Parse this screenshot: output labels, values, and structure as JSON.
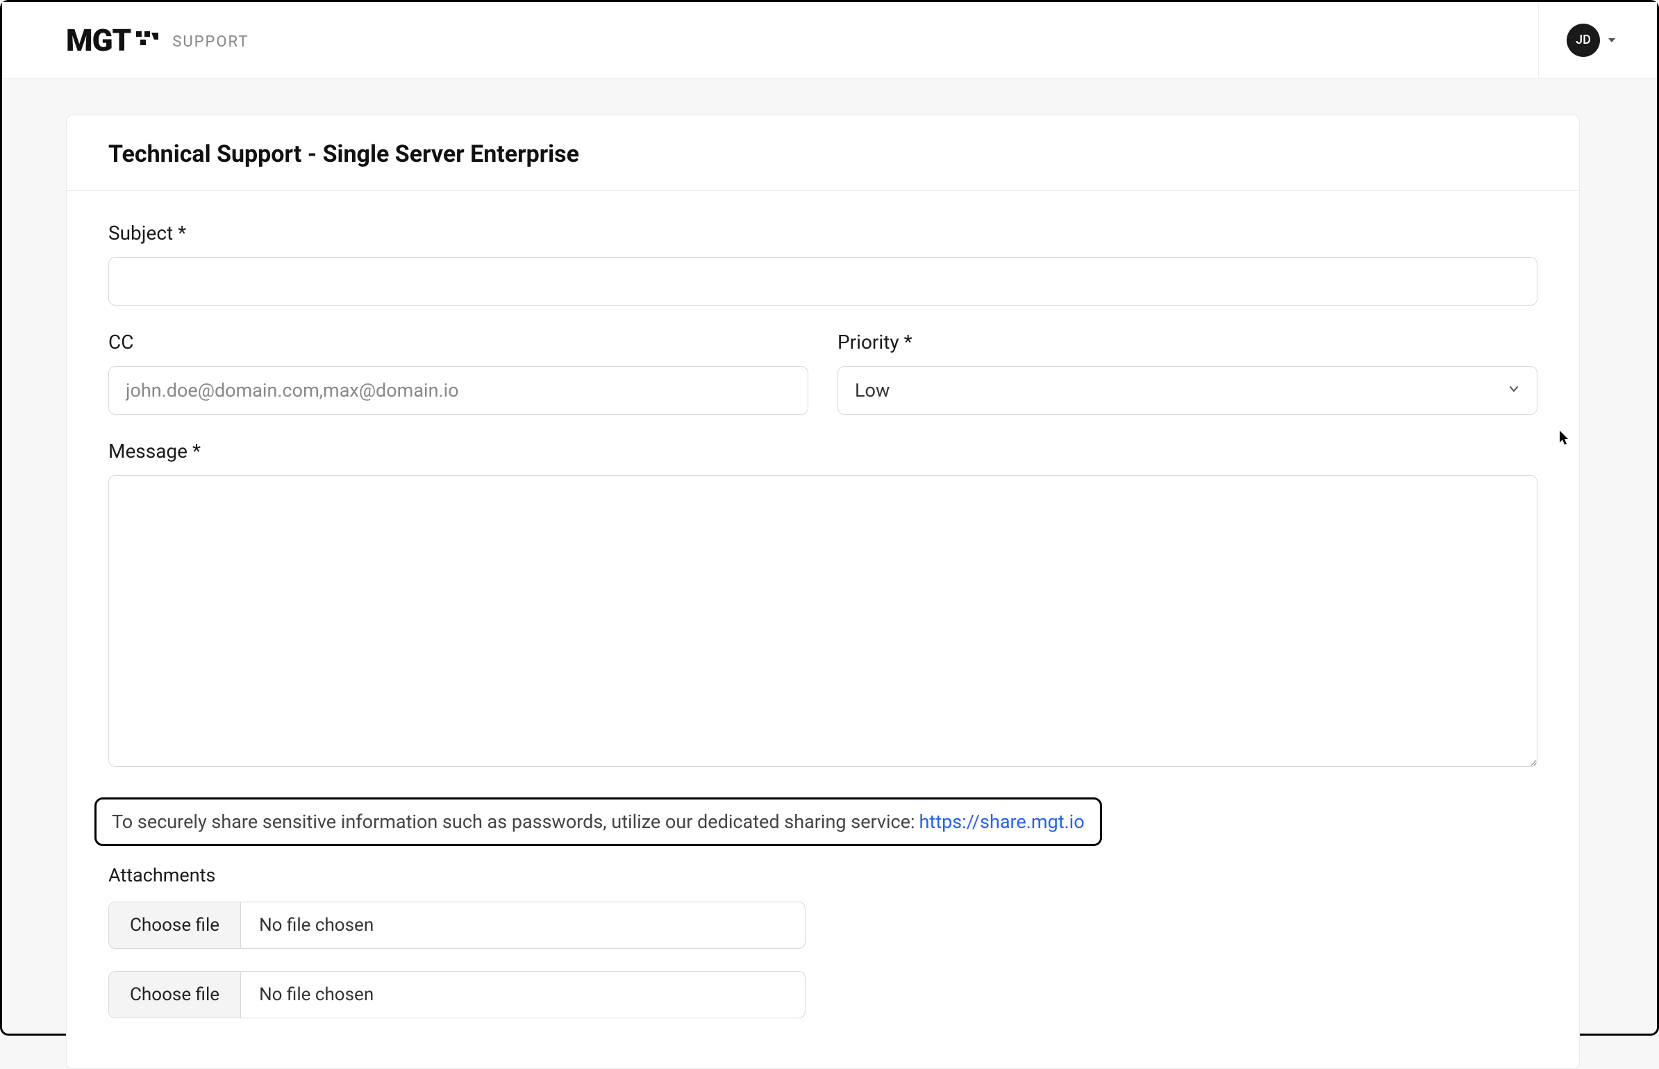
{
  "header": {
    "logo_text": "MGT",
    "support_label": "SUPPORT",
    "user_initials": "JD"
  },
  "page": {
    "title": "Technical Support - Single Server Enterprise"
  },
  "form": {
    "subject_label": "Subject *",
    "subject_value": "",
    "cc_label": "CC",
    "cc_placeholder": "john.doe@domain.com,max@domain.io",
    "cc_value": "",
    "priority_label": "Priority *",
    "priority_value": "Low",
    "message_label": "Message *",
    "message_value": "",
    "notice_text": "To securely share sensitive information such as passwords, utilize our dedicated sharing service: ",
    "notice_link_text": "https://share.mgt.io",
    "attachments_label": "Attachments",
    "file_button_label": "Choose file",
    "file_status_1": "No file chosen",
    "file_status_2": "No file chosen"
  }
}
